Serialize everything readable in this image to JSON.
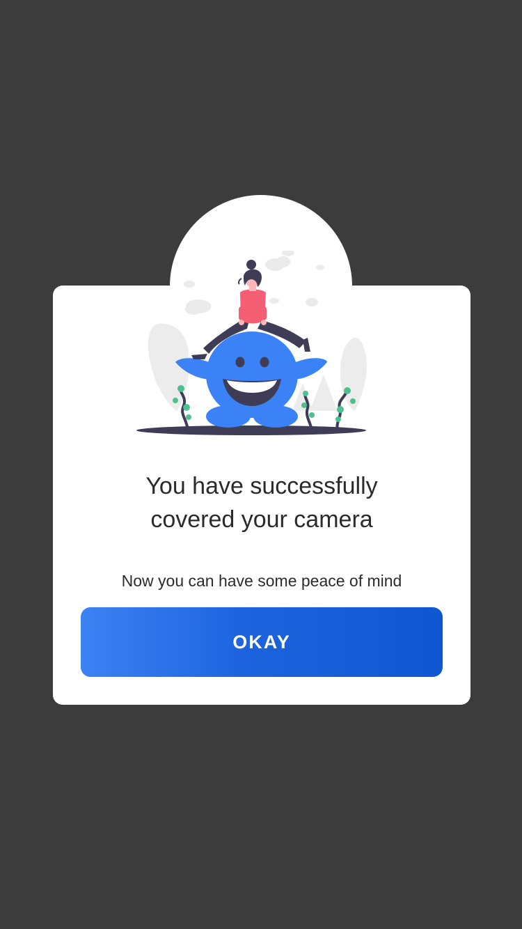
{
  "dialog": {
    "title_line1": "You have successfully",
    "title_line2": "covered your camera",
    "subtitle": "Now you can have some peace of mind",
    "ok_button_label": "OKAY"
  },
  "colors": {
    "overlay_background": "#3c3c3c",
    "card_background": "#ffffff",
    "button_gradient_start": "#3d82f3",
    "button_gradient_end": "#0f57d2",
    "monster_blue": "#3b82f6",
    "shirt_pink": "#f55f73",
    "ground_shadow": "#3f3d56"
  },
  "illustration": {
    "icon": "monster-with-rider-illustration"
  }
}
